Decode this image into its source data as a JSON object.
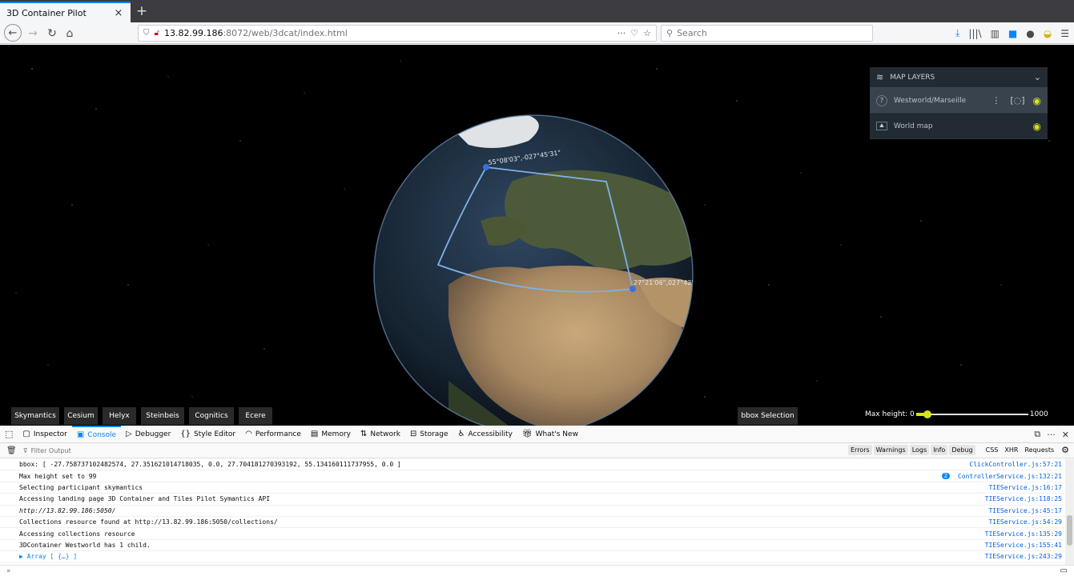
{
  "browser": {
    "tab_title": "3D Container Pilot",
    "tab_close": "×",
    "new_tab": "+",
    "url_host": "13.82.99.186",
    "url_path": ":8072/web/3dcat/index.html",
    "page_actions": "···",
    "search_placeholder": "Search"
  },
  "viewer": {
    "globe_labels": {
      "nw_corner": "55°08'03\",-027°45'31\"",
      "se_corner": "27°21'06\",027°42'"
    },
    "layers_panel": {
      "title": "MAP LAYERS",
      "layers": [
        {
          "name": "Westworld/Marseille",
          "menu": "⋮",
          "visible": true
        },
        {
          "name": "World map",
          "visible": true
        }
      ]
    },
    "participants": [
      "Skymantics",
      "Cesium",
      "Helyx",
      "Steinbeis",
      "Cognitics",
      "Ecere"
    ],
    "bbox_button": "bbox Selection",
    "max_height": {
      "label": "Max height: 0",
      "max_label": "1000",
      "value": 99,
      "min": 0,
      "max": 1000
    }
  },
  "devtools": {
    "tabs": [
      {
        "label": "Inspector",
        "icon": "inspector-icon"
      },
      {
        "label": "Console",
        "icon": "console-icon",
        "active": true
      },
      {
        "label": "Debugger",
        "icon": "debugger-icon"
      },
      {
        "label": "Style Editor",
        "icon": "style-editor-icon"
      },
      {
        "label": "Performance",
        "icon": "performance-icon"
      },
      {
        "label": "Memory",
        "icon": "memory-icon"
      },
      {
        "label": "Network",
        "icon": "network-icon"
      },
      {
        "label": "Storage",
        "icon": "storage-icon"
      },
      {
        "label": "Accessibility",
        "icon": "accessibility-icon"
      },
      {
        "label": "What's New",
        "icon": "whats-new-icon"
      }
    ],
    "filter_placeholder": "Filter Output",
    "filter_buttons": [
      "Errors",
      "Warnings",
      "Logs",
      "Info",
      "Debug"
    ],
    "extra_filters": [
      "CSS",
      "XHR",
      "Requests"
    ],
    "console_lines": [
      {
        "text": "bbox: [ -27.758737102482574, 27.351621014718035, 0.0, 27.704181270393192, 55.134160111737955, 0.0 ]",
        "source": "ClickController.js:57:21"
      },
      {
        "text": "Max height set to 99",
        "source": "ControllerService.js:132:21",
        "badge": "2"
      },
      {
        "text": "Selecting participant skymantics",
        "source": "TIEService.js:16:17"
      },
      {
        "text": "Accessing landing page 3D Container and Tiles Pilot Symantics API",
        "source": "TIEService.js:118:25"
      },
      {
        "text": "http://13.82.99.186:5050/",
        "source": "TIEService.js:45:17",
        "italic": true
      },
      {
        "text": "Collections resource found at http://13.82.99.186:5050/collections/",
        "source": "TIEService.js:54:29"
      },
      {
        "text": "Accessing collections resource",
        "source": "TIEService.js:135:29"
      },
      {
        "text": "3DContainer Westworld has 1 child.",
        "source": "TIEService.js:155:41"
      },
      {
        "text": "▶ Array [ {…} ]",
        "source": "TIEService.js:243:29",
        "array": true
      }
    ],
    "prompt": "»"
  }
}
